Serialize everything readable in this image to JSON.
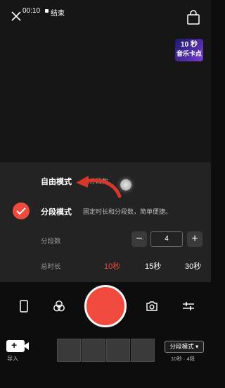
{
  "status": {
    "time": "00:10",
    "end_label": "结束"
  },
  "music_badge": {
    "line1": "10 秒",
    "line2": "音乐卡点"
  },
  "modes": {
    "free": {
      "label": "自由模式",
      "description_partial": "扣分段数。"
    },
    "segment": {
      "label": "分段模式",
      "description": "固定时长和分段数，简单便捷。",
      "selected": true
    }
  },
  "segment_count": {
    "label": "分段数",
    "value": "4",
    "minus": "−",
    "plus": "+"
  },
  "duration": {
    "label": "总时长",
    "options": [
      "10秒",
      "15秒",
      "30秒"
    ],
    "selected": "10秒"
  },
  "bottom": {
    "import_label": "导入",
    "mode_select": "分段模式",
    "mode_caption": "10秒 · 4段"
  },
  "colors": {
    "accent": "#f04a3e",
    "panel": "#232323",
    "badge_start": "#1c1c6e",
    "badge_end": "#7a3bd6"
  },
  "icons": [
    "close-icon",
    "shopping-bag-icon",
    "phone-icon",
    "filter-icon",
    "camera-flip-icon",
    "adjust-icon",
    "video-camera-icon",
    "chevron-down-icon",
    "check-icon",
    "arrow-icon"
  ]
}
